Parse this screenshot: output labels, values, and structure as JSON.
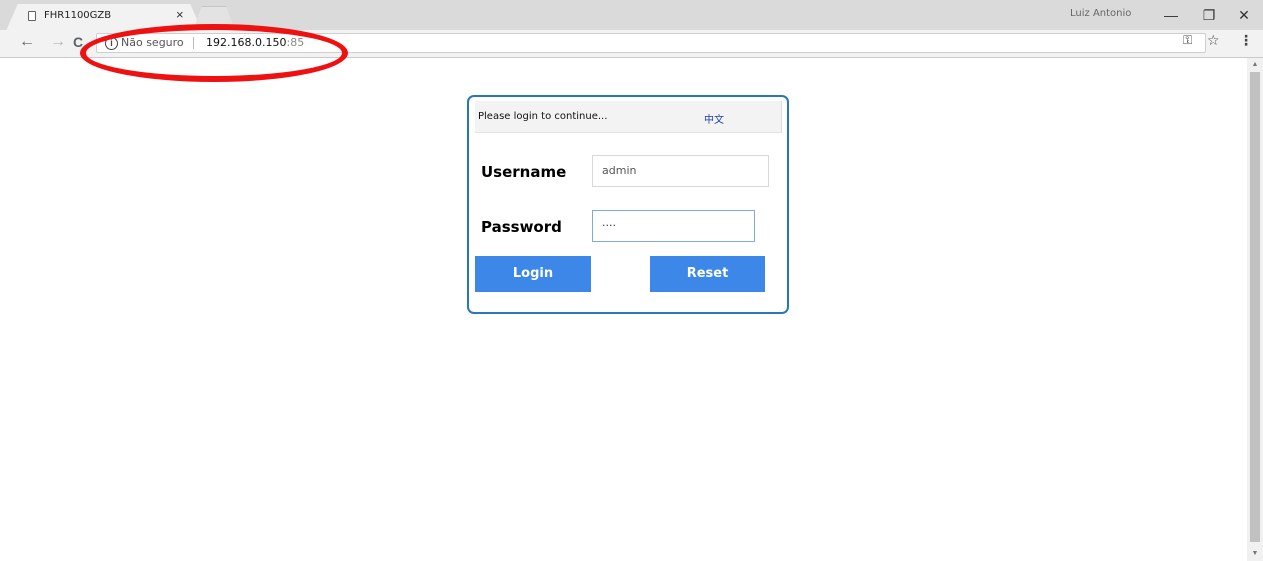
{
  "browser": {
    "tab_title": "FHR1100GZB",
    "tab_close": "×",
    "profile_name": "Luiz Antonio",
    "window_buttons": {
      "minimize": "—",
      "maximize": "❐",
      "close": "✕"
    },
    "nav": {
      "back": "←",
      "forward": "→",
      "reload": "C"
    },
    "security_text": "Não seguro",
    "url_host": "192.168.0.150",
    "url_port": ":85",
    "key_icon": "key-icon",
    "star_icon": "star-icon",
    "menu_icon": "menu-icon",
    "glyphs": {
      "info": "i",
      "key": "⚿",
      "star": "☆",
      "menu": "⋮",
      "scroll_up": "▲",
      "scroll_down": "▼"
    }
  },
  "login": {
    "prompt": "Please login to continue...",
    "language_link": "中文",
    "username_label": "Username",
    "username_value": "admin",
    "password_label": "Password",
    "password_value": "····",
    "login_button": "Login",
    "reset_button": "Reset"
  },
  "colors": {
    "panel_border": "#2a77b8",
    "button": "#3d87e8",
    "annotation": "#ee1111"
  }
}
